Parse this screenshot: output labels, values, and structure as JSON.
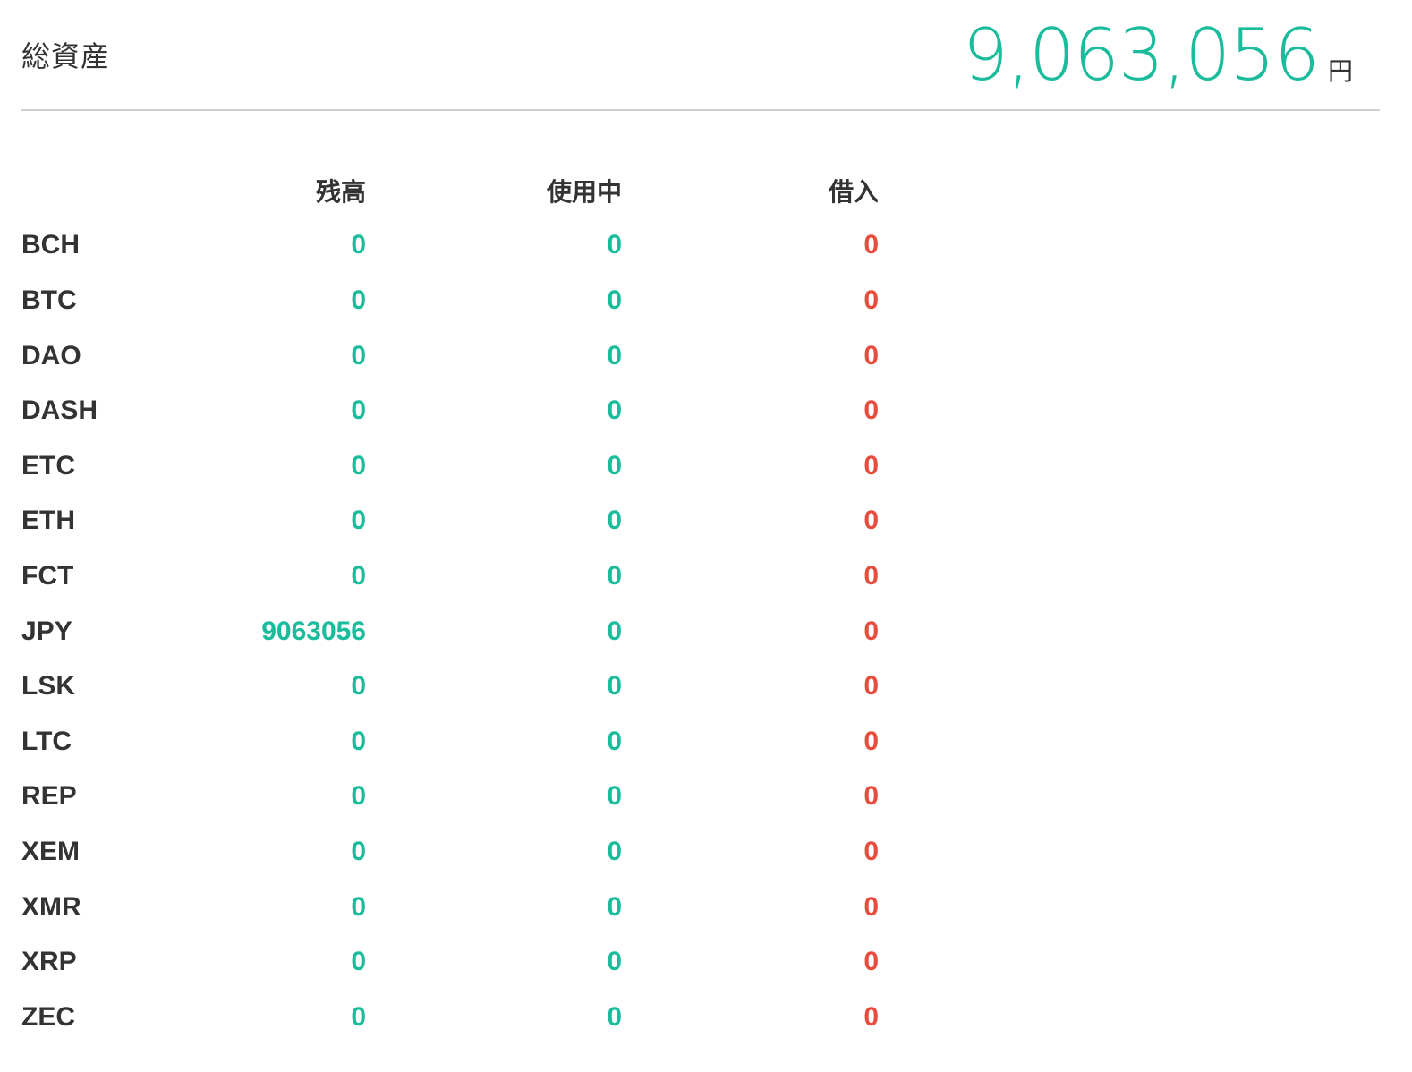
{
  "header": {
    "title": "総資産",
    "total_value": "9,063,056",
    "total_unit": "円"
  },
  "colors": {
    "positive": "#1abc9c",
    "negative": "#e74c3c",
    "text": "#333333",
    "divider": "#cfcfcf"
  },
  "table": {
    "columns": [
      "",
      "残高",
      "使用中",
      "借入"
    ],
    "rows": [
      {
        "currency": "BCH",
        "balance": "0",
        "in_use": "0",
        "borrowed": "0"
      },
      {
        "currency": "BTC",
        "balance": "0",
        "in_use": "0",
        "borrowed": "0"
      },
      {
        "currency": "DAO",
        "balance": "0",
        "in_use": "0",
        "borrowed": "0"
      },
      {
        "currency": "DASH",
        "balance": "0",
        "in_use": "0",
        "borrowed": "0"
      },
      {
        "currency": "ETC",
        "balance": "0",
        "in_use": "0",
        "borrowed": "0"
      },
      {
        "currency": "ETH",
        "balance": "0",
        "in_use": "0",
        "borrowed": "0"
      },
      {
        "currency": "FCT",
        "balance": "0",
        "in_use": "0",
        "borrowed": "0"
      },
      {
        "currency": "JPY",
        "balance": "9063056",
        "in_use": "0",
        "borrowed": "0"
      },
      {
        "currency": "LSK",
        "balance": "0",
        "in_use": "0",
        "borrowed": "0"
      },
      {
        "currency": "LTC",
        "balance": "0",
        "in_use": "0",
        "borrowed": "0"
      },
      {
        "currency": "REP",
        "balance": "0",
        "in_use": "0",
        "borrowed": "0"
      },
      {
        "currency": "XEM",
        "balance": "0",
        "in_use": "0",
        "borrowed": "0"
      },
      {
        "currency": "XMR",
        "balance": "0",
        "in_use": "0",
        "borrowed": "0"
      },
      {
        "currency": "XRP",
        "balance": "0",
        "in_use": "0",
        "borrowed": "0"
      },
      {
        "currency": "ZEC",
        "balance": "0",
        "in_use": "0",
        "borrowed": "0"
      }
    ]
  }
}
